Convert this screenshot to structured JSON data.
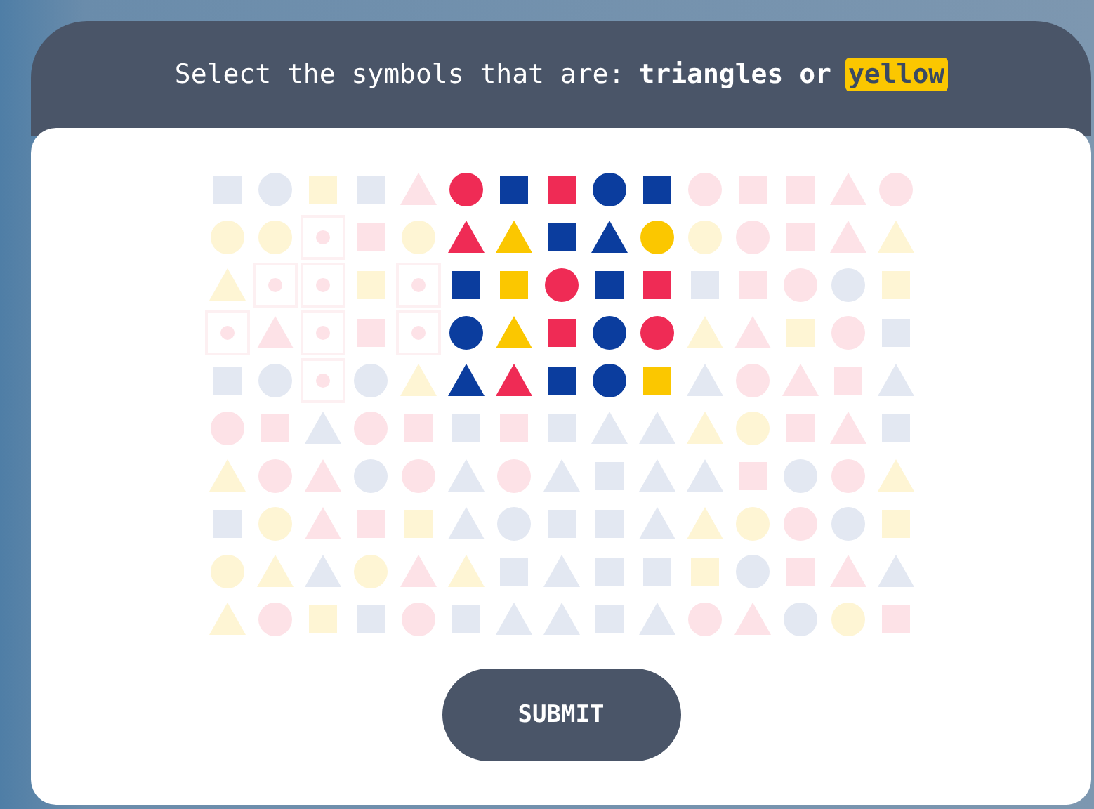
{
  "prompt": {
    "text": "Select the symbols that are:",
    "criteria": "triangles or",
    "highlight": "yellow"
  },
  "grid": {
    "rows": [
      {
        "cells": [
          {
            "kind": "square",
            "color": "#e3e8f2"
          },
          {
            "kind": "circle",
            "color": "#e3e8f2"
          },
          {
            "kind": "square",
            "color": "#fef5d4"
          },
          {
            "kind": "square",
            "color": "#e3e8f2"
          },
          {
            "kind": "triangle",
            "color": "#fde2e7"
          },
          {
            "kind": "circle",
            "color": "#ef2b55"
          },
          {
            "kind": "square",
            "color": "#0b3d9e"
          },
          {
            "kind": "square",
            "color": "#ef2b55"
          },
          {
            "kind": "circle",
            "color": "#0b3d9e"
          },
          {
            "kind": "square",
            "color": "#0b3d9e"
          },
          {
            "kind": "circle",
            "color": "#fde2e7"
          },
          {
            "kind": "square",
            "color": "#fde2e7"
          },
          {
            "kind": "square",
            "color": "#fde2e7"
          },
          {
            "kind": "triangle",
            "color": "#fde2e7"
          },
          {
            "kind": "circle",
            "color": "#fde2e7"
          }
        ]
      },
      {
        "cells": [
          {
            "kind": "circle",
            "color": "#fef5d4"
          },
          {
            "kind": "circle",
            "color": "#fef5d4"
          },
          {
            "kind": "mark",
            "color": "#fde2e7"
          },
          {
            "kind": "square",
            "color": "#fde2e7"
          },
          {
            "kind": "circle",
            "color": "#fef5d4"
          },
          {
            "kind": "triangle",
            "color": "#ef2b55"
          },
          {
            "kind": "triangle",
            "color": "#fbc700"
          },
          {
            "kind": "square",
            "color": "#0b3d9e"
          },
          {
            "kind": "triangle",
            "color": "#0b3d9e"
          },
          {
            "kind": "circle",
            "color": "#fbc700"
          },
          {
            "kind": "circle",
            "color": "#fef5d4"
          },
          {
            "kind": "circle",
            "color": "#fde2e7"
          },
          {
            "kind": "square",
            "color": "#fde2e7"
          },
          {
            "kind": "triangle",
            "color": "#fde2e7"
          },
          {
            "kind": "triangle",
            "color": "#fef5d4"
          }
        ]
      },
      {
        "cells": [
          {
            "kind": "triangle",
            "color": "#fef5d4"
          },
          {
            "kind": "mark",
            "color": "#fde2e7"
          },
          {
            "kind": "mark",
            "color": "#fde2e7"
          },
          {
            "kind": "square",
            "color": "#fef5d4"
          },
          {
            "kind": "mark",
            "color": "#fde2e7"
          },
          {
            "kind": "square",
            "color": "#0b3d9e"
          },
          {
            "kind": "square",
            "color": "#fbc700"
          },
          {
            "kind": "circle",
            "color": "#ef2b55"
          },
          {
            "kind": "square",
            "color": "#0b3d9e"
          },
          {
            "kind": "square",
            "color": "#ef2b55"
          },
          {
            "kind": "square",
            "color": "#e3e8f2"
          },
          {
            "kind": "square",
            "color": "#fde2e7"
          },
          {
            "kind": "circle",
            "color": "#fde2e7"
          },
          {
            "kind": "circle",
            "color": "#e3e8f2"
          },
          {
            "kind": "square",
            "color": "#fef5d4"
          }
        ]
      },
      {
        "cells": [
          {
            "kind": "mark",
            "color": "#fde2e7"
          },
          {
            "kind": "triangle",
            "color": "#fde2e7"
          },
          {
            "kind": "mark",
            "color": "#fde2e7"
          },
          {
            "kind": "square",
            "color": "#fde2e7"
          },
          {
            "kind": "mark",
            "color": "#fde2e7"
          },
          {
            "kind": "circle",
            "color": "#0b3d9e"
          },
          {
            "kind": "triangle",
            "color": "#fbc700"
          },
          {
            "kind": "square",
            "color": "#ef2b55"
          },
          {
            "kind": "circle",
            "color": "#0b3d9e"
          },
          {
            "kind": "circle",
            "color": "#ef2b55"
          },
          {
            "kind": "triangle",
            "color": "#fef5d4"
          },
          {
            "kind": "triangle",
            "color": "#fde2e7"
          },
          {
            "kind": "square",
            "color": "#fef5d4"
          },
          {
            "kind": "circle",
            "color": "#fde2e7"
          },
          {
            "kind": "square",
            "color": "#e3e8f2"
          }
        ]
      },
      {
        "cells": [
          {
            "kind": "square",
            "color": "#e3e8f2"
          },
          {
            "kind": "circle",
            "color": "#e3e8f2"
          },
          {
            "kind": "mark",
            "color": "#fde2e7"
          },
          {
            "kind": "circle",
            "color": "#e3e8f2"
          },
          {
            "kind": "triangle",
            "color": "#fef5d4"
          },
          {
            "kind": "triangle",
            "color": "#0b3d9e"
          },
          {
            "kind": "triangle",
            "color": "#ef2b55"
          },
          {
            "kind": "square",
            "color": "#0b3d9e"
          },
          {
            "kind": "circle",
            "color": "#0b3d9e"
          },
          {
            "kind": "square",
            "color": "#fbc700"
          },
          {
            "kind": "triangle",
            "color": "#e3e8f2"
          },
          {
            "kind": "circle",
            "color": "#fde2e7"
          },
          {
            "kind": "triangle",
            "color": "#fde2e7"
          },
          {
            "kind": "square",
            "color": "#fde2e7"
          },
          {
            "kind": "triangle",
            "color": "#e3e8f2"
          }
        ]
      },
      {
        "cells": [
          {
            "kind": "circle",
            "color": "#fde2e7"
          },
          {
            "kind": "square",
            "color": "#fde2e7"
          },
          {
            "kind": "triangle",
            "color": "#e3e8f2"
          },
          {
            "kind": "circle",
            "color": "#fde2e7"
          },
          {
            "kind": "square",
            "color": "#fde2e7"
          },
          {
            "kind": "square",
            "color": "#e3e8f2"
          },
          {
            "kind": "square",
            "color": "#fde2e7"
          },
          {
            "kind": "square",
            "color": "#e3e8f2"
          },
          {
            "kind": "triangle",
            "color": "#e3e8f2"
          },
          {
            "kind": "triangle",
            "color": "#e3e8f2"
          },
          {
            "kind": "triangle",
            "color": "#fef5d4"
          },
          {
            "kind": "circle",
            "color": "#fef5d4"
          },
          {
            "kind": "square",
            "color": "#fde2e7"
          },
          {
            "kind": "triangle",
            "color": "#fde2e7"
          },
          {
            "kind": "square",
            "color": "#e3e8f2"
          }
        ]
      },
      {
        "cells": [
          {
            "kind": "triangle",
            "color": "#fef5d4"
          },
          {
            "kind": "circle",
            "color": "#fde2e7"
          },
          {
            "kind": "triangle",
            "color": "#fde2e7"
          },
          {
            "kind": "circle",
            "color": "#e3e8f2"
          },
          {
            "kind": "circle",
            "color": "#fde2e7"
          },
          {
            "kind": "triangle",
            "color": "#e3e8f2"
          },
          {
            "kind": "circle",
            "color": "#fde2e7"
          },
          {
            "kind": "triangle",
            "color": "#e3e8f2"
          },
          {
            "kind": "square",
            "color": "#e3e8f2"
          },
          {
            "kind": "triangle",
            "color": "#e3e8f2"
          },
          {
            "kind": "triangle",
            "color": "#e3e8f2"
          },
          {
            "kind": "square",
            "color": "#fde2e7"
          },
          {
            "kind": "circle",
            "color": "#e3e8f2"
          },
          {
            "kind": "circle",
            "color": "#fde2e7"
          },
          {
            "kind": "triangle",
            "color": "#fef5d4"
          }
        ]
      },
      {
        "cells": [
          {
            "kind": "square",
            "color": "#e3e8f2"
          },
          {
            "kind": "circle",
            "color": "#fef5d4"
          },
          {
            "kind": "triangle",
            "color": "#fde2e7"
          },
          {
            "kind": "square",
            "color": "#fde2e7"
          },
          {
            "kind": "square",
            "color": "#fef5d4"
          },
          {
            "kind": "triangle",
            "color": "#e3e8f2"
          },
          {
            "kind": "circle",
            "color": "#e3e8f2"
          },
          {
            "kind": "square",
            "color": "#e3e8f2"
          },
          {
            "kind": "square",
            "color": "#e3e8f2"
          },
          {
            "kind": "triangle",
            "color": "#e3e8f2"
          },
          {
            "kind": "triangle",
            "color": "#fef5d4"
          },
          {
            "kind": "circle",
            "color": "#fef5d4"
          },
          {
            "kind": "circle",
            "color": "#fde2e7"
          },
          {
            "kind": "circle",
            "color": "#e3e8f2"
          },
          {
            "kind": "square",
            "color": "#fef5d4"
          }
        ]
      },
      {
        "cells": [
          {
            "kind": "circle",
            "color": "#fef5d4"
          },
          {
            "kind": "triangle",
            "color": "#fef5d4"
          },
          {
            "kind": "triangle",
            "color": "#e3e8f2"
          },
          {
            "kind": "circle",
            "color": "#fef5d4"
          },
          {
            "kind": "triangle",
            "color": "#fde2e7"
          },
          {
            "kind": "triangle",
            "color": "#fef5d4"
          },
          {
            "kind": "square",
            "color": "#e3e8f2"
          },
          {
            "kind": "triangle",
            "color": "#e3e8f2"
          },
          {
            "kind": "square",
            "color": "#e3e8f2"
          },
          {
            "kind": "square",
            "color": "#e3e8f2"
          },
          {
            "kind": "square",
            "color": "#fef5d4"
          },
          {
            "kind": "circle",
            "color": "#e3e8f2"
          },
          {
            "kind": "square",
            "color": "#fde2e7"
          },
          {
            "kind": "triangle",
            "color": "#fde2e7"
          },
          {
            "kind": "triangle",
            "color": "#e3e8f2"
          }
        ]
      },
      {
        "cells": [
          {
            "kind": "triangle",
            "color": "#fef5d4"
          },
          {
            "kind": "circle",
            "color": "#fde2e7"
          },
          {
            "kind": "square",
            "color": "#fef5d4"
          },
          {
            "kind": "square",
            "color": "#e3e8f2"
          },
          {
            "kind": "circle",
            "color": "#fde2e7"
          },
          {
            "kind": "square",
            "color": "#e3e8f2"
          },
          {
            "kind": "triangle",
            "color": "#e3e8f2"
          },
          {
            "kind": "triangle",
            "color": "#e3e8f2"
          },
          {
            "kind": "square",
            "color": "#e3e8f2"
          },
          {
            "kind": "triangle",
            "color": "#e3e8f2"
          },
          {
            "kind": "circle",
            "color": "#fde2e7"
          },
          {
            "kind": "triangle",
            "color": "#fde2e7"
          },
          {
            "kind": "circle",
            "color": "#e3e8f2"
          },
          {
            "kind": "circle",
            "color": "#fef5d4"
          },
          {
            "kind": "square",
            "color": "#fde2e7"
          }
        ]
      }
    ]
  },
  "submit": {
    "label": "SUBMIT"
  }
}
